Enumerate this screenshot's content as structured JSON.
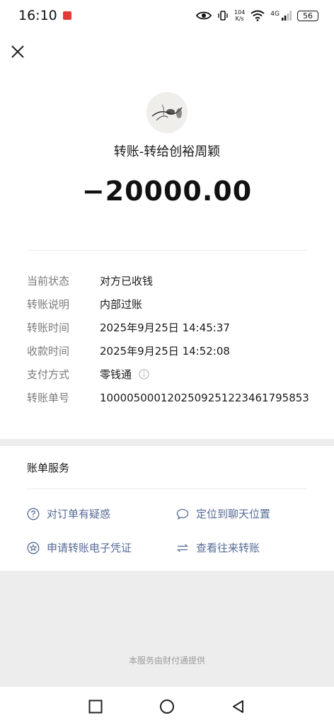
{
  "status_bar": {
    "time": "16:10",
    "net_speed_value": "104",
    "net_speed_unit": "K/s",
    "signal_label": "4G",
    "battery": "56"
  },
  "header": {
    "close_icon": "close-icon"
  },
  "transfer": {
    "avatar_icon": "avatar-image",
    "title": "转账-转给创裕周颖",
    "amount": "−20000.00"
  },
  "details": [
    {
      "label": "当前状态",
      "value": "对方已收钱"
    },
    {
      "label": "转账说明",
      "value": "内部过账"
    },
    {
      "label": "转账时间",
      "value": "2025年9月25日 14:45:37"
    },
    {
      "label": "收款时间",
      "value": "2025年9月25日 14:52:08"
    },
    {
      "label": "支付方式",
      "value": "零钱通"
    },
    {
      "label": "转账单号",
      "value": "1000050001202509251223461795853"
    }
  ],
  "services": {
    "title": "账单服务",
    "items": [
      {
        "label": "对订单有疑惑",
        "icon": "question-icon"
      },
      {
        "label": "定位到聊天位置",
        "icon": "chat-bubble-icon"
      },
      {
        "label": "申请转账电子凭证",
        "icon": "badge-star-icon"
      },
      {
        "label": "查看往来转账",
        "icon": "exchange-arrows-icon"
      }
    ]
  },
  "footer": {
    "provider_text": "本服务由财付通提供"
  },
  "colors": {
    "link": "#576b95",
    "background": "#ededed"
  }
}
